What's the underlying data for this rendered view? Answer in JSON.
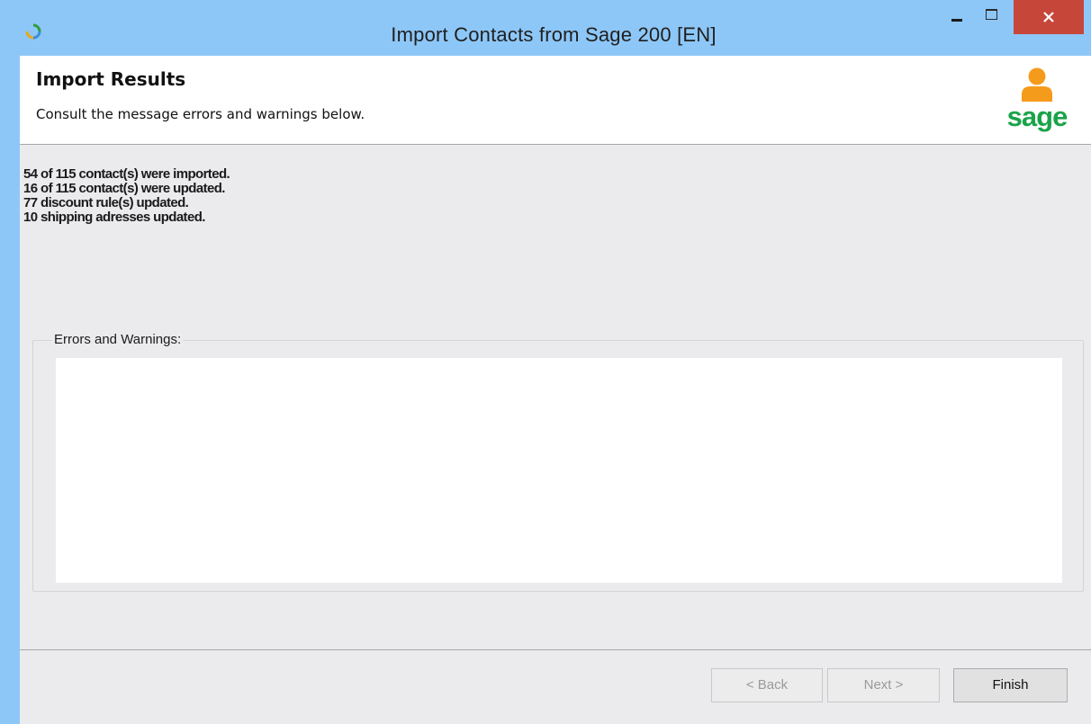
{
  "window": {
    "title": "Import Contacts from Sage 200 [EN]",
    "close_glyph": "×"
  },
  "header": {
    "title": "Import Results",
    "subtitle": "Consult the message errors and warnings below.",
    "logo_text": "sage"
  },
  "summary": {
    "lines": [
      "54 of 115 contact(s) were imported.",
      "16 of 115 contact(s) were updated.",
      "77 discount rule(s) updated.",
      "10 shipping adresses updated."
    ]
  },
  "errors_group": {
    "label": "Errors and Warnings:",
    "messages": ""
  },
  "buttons": {
    "back": "< Back",
    "next": "Next >",
    "finish": "Finish"
  },
  "colors": {
    "titlebar": "#8dc7f7",
    "close_button": "#c7463a",
    "sage_orange": "#f59b1c",
    "sage_green": "#1aa34a",
    "panel_background": "#ebebee"
  },
  "icons": {
    "app": "refresh-icon",
    "logo": "sage-person-icon"
  }
}
